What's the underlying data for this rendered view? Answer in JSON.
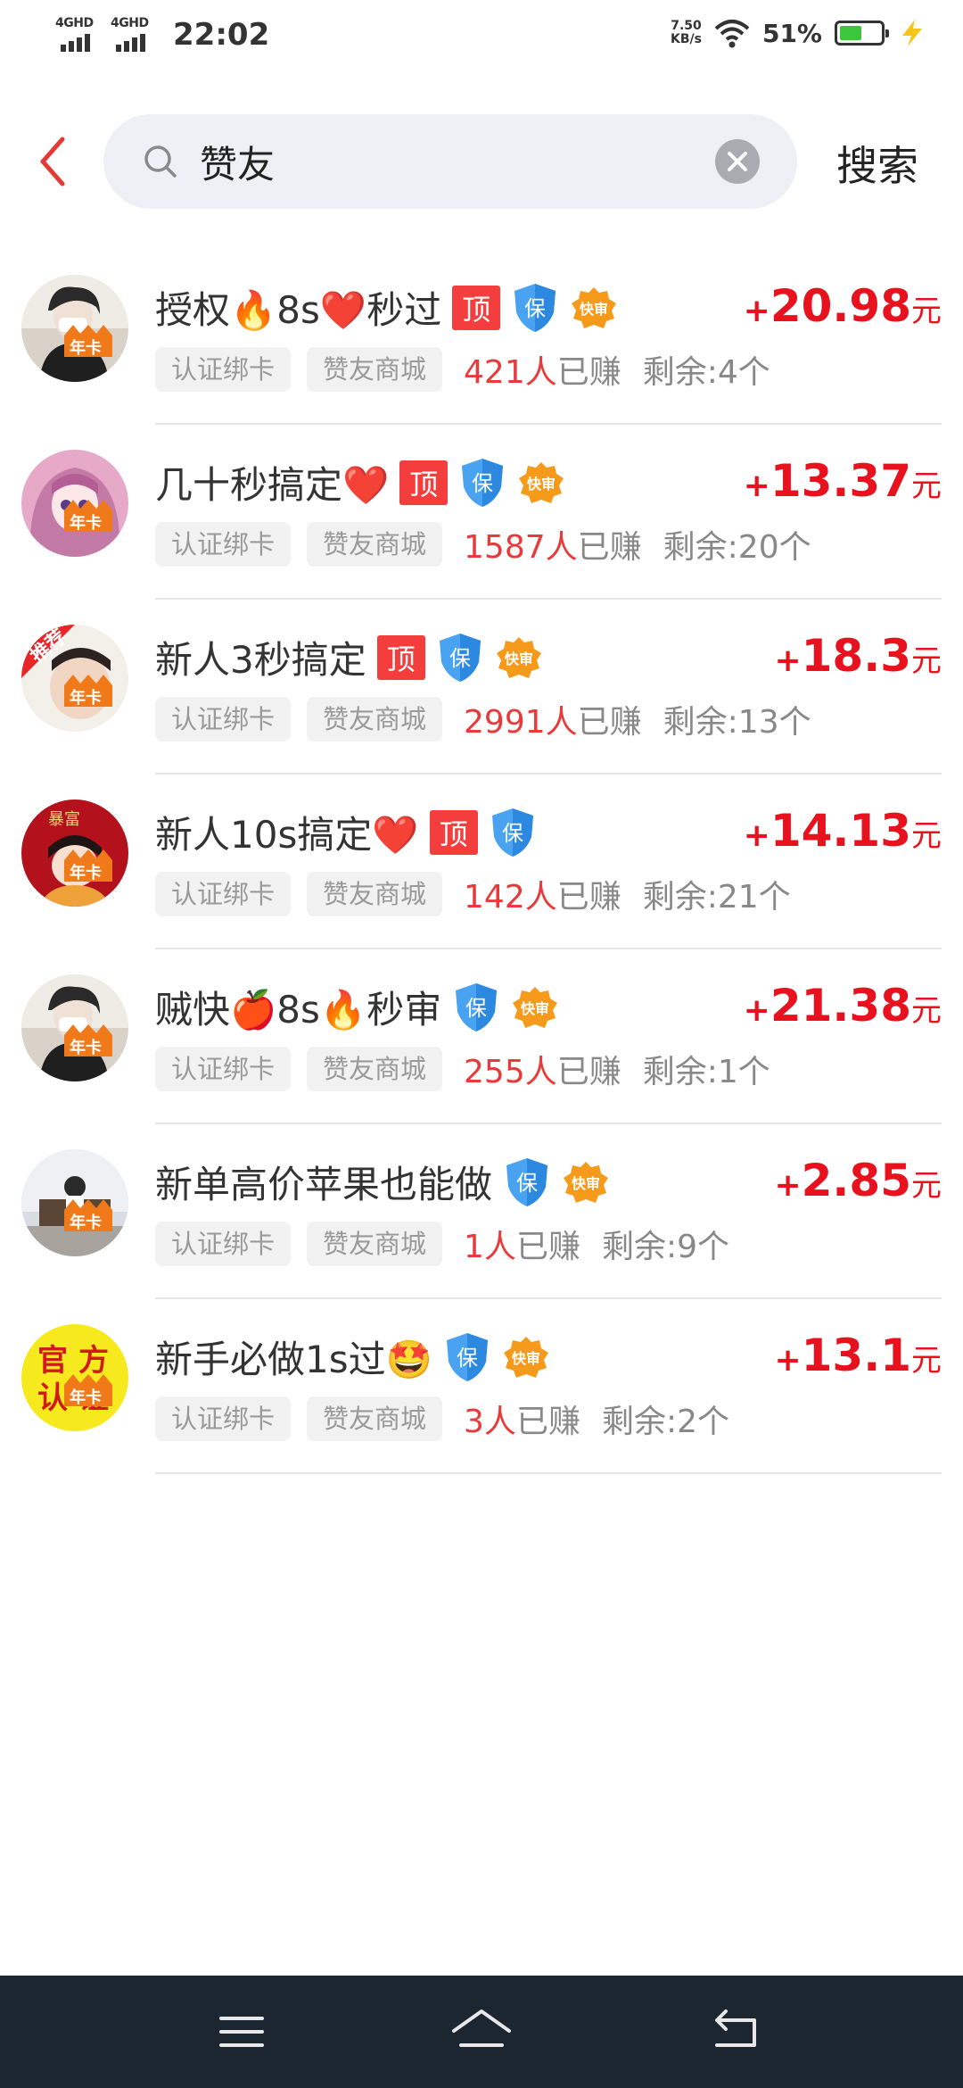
{
  "status_bar": {
    "network1": "4GHD",
    "network2": "4GHD",
    "time": "22:02",
    "speed_value": "7.50",
    "speed_unit": "KB/s",
    "battery": "51%"
  },
  "search": {
    "query": "赞友",
    "search_label": "搜索",
    "icons": [
      "back-arrow-icon",
      "search-icon",
      "clear-icon"
    ]
  },
  "badges": {
    "ding": "顶",
    "bao": "保",
    "kuai": "快审",
    "nianka": "年卡"
  },
  "tasks": [
    {
      "title": "授权🔥8s❤️秒过",
      "badges": [
        "ding",
        "bao",
        "kuai"
      ],
      "tag1": "认证绑卡",
      "tag2": "赞友商城",
      "earned_count": "421人",
      "earned_text": "已赚",
      "remain": "剩余:4个",
      "plus": "+",
      "price": "20.98",
      "unit": "元",
      "avatar": "photo"
    },
    {
      "title": "几十秒搞定❤️",
      "badges": [
        "ding",
        "bao",
        "kuai"
      ],
      "tag1": "认证绑卡",
      "tag2": "赞友商城",
      "earned_count": "1587人",
      "earned_text": "已赚",
      "remain": "剩余:20个",
      "plus": "+",
      "price": "13.37",
      "unit": "元",
      "avatar": "anime"
    },
    {
      "title": "新人3秒搞定",
      "badges": [
        "ding",
        "bao",
        "kuai"
      ],
      "tag1": "认证绑卡",
      "tag2": "赞友商城",
      "earned_count": "2991人",
      "earned_text": "已赚",
      "remain": "剩余:13个",
      "plus": "+",
      "price": "18.3",
      "unit": "元",
      "avatar": "recommend",
      "avatar_text": "推荐"
    },
    {
      "title": "新人10s搞定❤️",
      "badges": [
        "ding",
        "bao"
      ],
      "tag1": "认证绑卡",
      "tag2": "赞友商城",
      "earned_count": "142人",
      "earned_text": "已赚",
      "remain": "剩余:21个",
      "plus": "+",
      "price": "14.13",
      "unit": "元",
      "avatar": "red",
      "avatar_text": "暴富"
    },
    {
      "title": "贼快🍎8s🔥秒审",
      "badges": [
        "bao",
        "kuai"
      ],
      "tag1": "认证绑卡",
      "tag2": "赞友商城",
      "earned_count": "255人",
      "earned_text": "已赚",
      "remain": "剩余:1个",
      "plus": "+",
      "price": "21.38",
      "unit": "元",
      "avatar": "photo"
    },
    {
      "title": "新单高价苹果也能做",
      "badges": [
        "bao",
        "kuai"
      ],
      "tag1": "认证绑卡",
      "tag2": "赞友商城",
      "earned_count": "1人",
      "earned_text": "已赚",
      "remain": "剩余:9个",
      "plus": "+",
      "price": "2.85",
      "unit": "元",
      "avatar": "room"
    },
    {
      "title": "新手必做1s过🤩",
      "badges": [
        "bao",
        "kuai"
      ],
      "tag1": "认证绑卡",
      "tag2": "赞友商城",
      "earned_count": "3人",
      "earned_text": "已赚",
      "remain": "剩余:2个",
      "plus": "+",
      "price": "13.1",
      "unit": "元",
      "avatar": "official",
      "avatar_text": "官方认证"
    }
  ],
  "nav": {
    "icons": [
      "menu-icon",
      "home-icon",
      "back-icon"
    ]
  },
  "colors": {
    "price": "#e8121e",
    "earned": "#e83a3a",
    "accent_back": "#e53935",
    "navbar": "#1c2631"
  }
}
